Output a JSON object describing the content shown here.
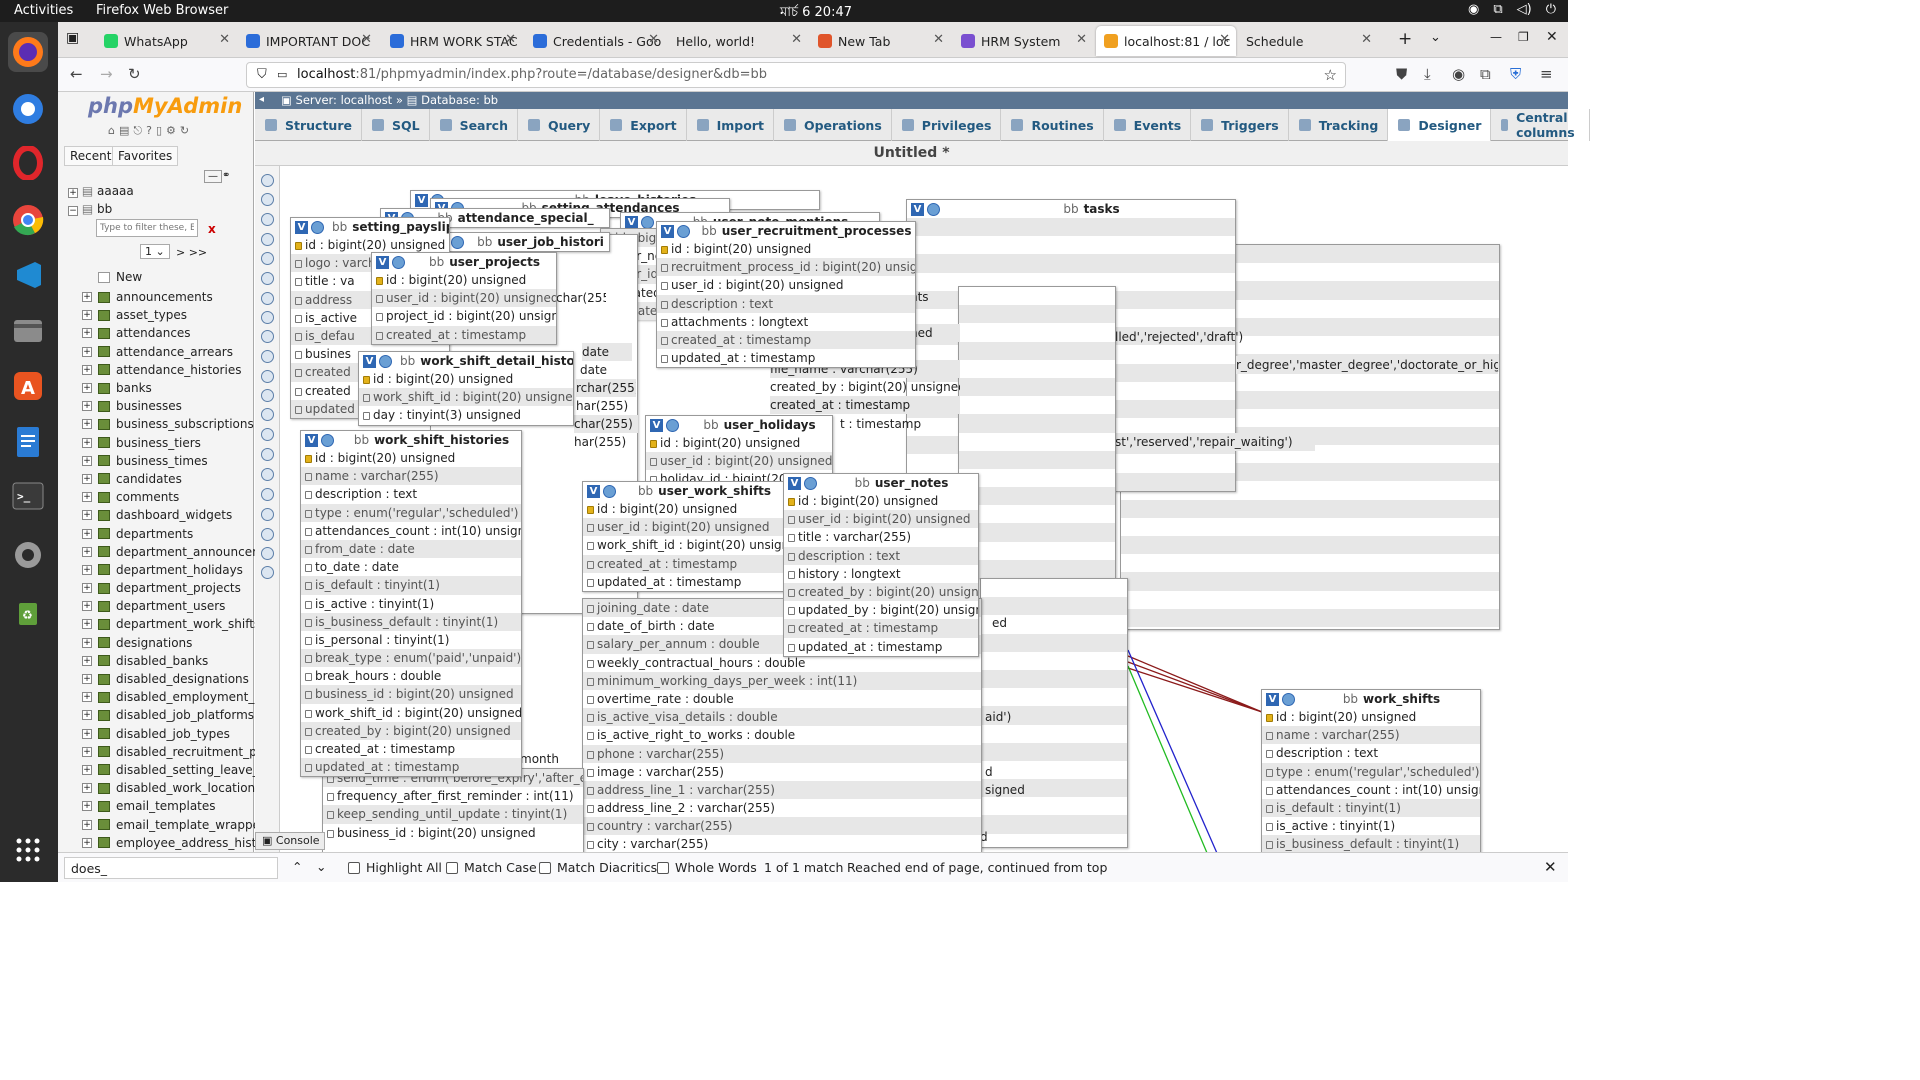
{
  "system": {
    "activities": "Activities",
    "app": "Firefox Web Browser",
    "clock": "মার্চ 6  20:47"
  },
  "tabs": [
    {
      "label": "WhatsApp",
      "color": "#25d366"
    },
    {
      "label": "IMPORTANT DOC",
      "color": "#2b6cd9"
    },
    {
      "label": "HRM WORK STAC",
      "color": "#2b6cd9"
    },
    {
      "label": "Credentials - Goo",
      "color": "#2b6cd9"
    },
    {
      "label": "Hello, world!",
      "color": ""
    },
    {
      "label": "New Tab",
      "color": "#e0552b"
    },
    {
      "label": "HRM System",
      "color": "#7a4fd0"
    },
    {
      "label": "localhost:81 / loc",
      "color": "#f0a020"
    },
    {
      "label": "Schedule",
      "color": ""
    }
  ],
  "url": {
    "host": "localhost",
    "rest": ":81/phpmyadmin/index.php?route=/database/designer&db=bb"
  },
  "sidebar": {
    "recent": "Recent",
    "favorites": "Favorites",
    "filter_placeholder": "Type to filter these, Enter",
    "filter_clear": "x",
    "page_select": "1",
    "page_next": "> >>",
    "dbs": [
      "aaaaa",
      "bb"
    ],
    "new_label": "New",
    "tables": [
      "announcements",
      "asset_types",
      "attendances",
      "attendance_arrears",
      "attendance_histories",
      "banks",
      "businesses",
      "business_subscriptions",
      "business_tiers",
      "business_times",
      "candidates",
      "comments",
      "dashboard_widgets",
      "departments",
      "department_announceme",
      "department_holidays",
      "department_projects",
      "department_users",
      "department_work_shifts",
      "designations",
      "disabled_banks",
      "disabled_designations",
      "disabled_employment_sta",
      "disabled_job_platforms",
      "disabled_job_types",
      "disabled_recruitment_proc",
      "disabled_setting_leave_typ",
      "disabled_work_locations",
      "email_templates",
      "email_template_wrappers",
      "employee_address_histori"
    ]
  },
  "breadcrumb": {
    "server": "Server: localhost",
    "sep": "»",
    "database": "Database: bb"
  },
  "menu": [
    "Structure",
    "SQL",
    "Search",
    "Query",
    "Export",
    "Import",
    "Operations",
    "Privileges",
    "Routines",
    "Events",
    "Triggers",
    "Tracking",
    "Designer",
    "Central columns"
  ],
  "designer_title": "Untitled *",
  "db_prefix": "bb",
  "tables": {
    "tasks": {
      "name": "tasks",
      "rows": []
    },
    "leave_histories": {
      "name": "leave_histories"
    },
    "attendance_special": {
      "name": "attendance_special_"
    },
    "setting_attendances": {
      "name": "setting_attendances"
    },
    "user_note_mentions": {
      "name": "user_note_mentions"
    },
    "setting_payslips": {
      "name": "setting_payslips",
      "rows": [
        "id : bigint(20) unsigned",
        "logo : varchar",
        "title : va",
        "address",
        "is_active",
        "is_defau",
        "busines",
        "created",
        "created",
        "updated"
      ]
    },
    "user_job_histories": {
      "name": "user_job_histori"
    },
    "user_projects": {
      "name": "user_projects",
      "rows": [
        "id : bigint(20) unsigned",
        "user_id : bigint(20) unsigned",
        "project_id : bigint(20) unsigned",
        "created_at : timestamp"
      ]
    },
    "user_recruitment_processes": {
      "name": "user_recruitment_processes",
      "rows": [
        "id : bigint(20) unsigned",
        "recruitment_process_id : bigint(20) unsigned",
        "user_id : bigint(20) unsigned",
        "description : text",
        "attachments : longtext",
        "created_at : timestamp",
        "updated_at : timestamp"
      ]
    },
    "work_shift_detail_histories": {
      "name": "work_shift_detail_histories",
      "rows": [
        "id : bigint(20) unsigned",
        "work_shift_id : bigint(20) unsigned",
        "day : tinyint(3) unsigned"
      ]
    },
    "user_holidays": {
      "name": "user_holidays",
      "rows": [
        "id : bigint(20) unsigned",
        "user_id : bigint(20) unsigned",
        "holiday_id : bigint(20)"
      ]
    },
    "work_shift_histories": {
      "name": "work_shift_histories",
      "rows": [
        "id : bigint(20) unsigned",
        "name : varchar(255)",
        "description : text",
        "type : enum('regular','scheduled')",
        "attendances_count : int(10) unsigned",
        "from_date : date",
        "to_date : date",
        "is_default : tinyint(1)",
        "is_active : tinyint(1)",
        "is_business_default : tinyint(1)",
        "is_personal : tinyint(1)",
        "break_type : enum('paid','unpaid')",
        "break_hours : double",
        "business_id : bigint(20) unsigned",
        "work_shift_id : bigint(20) unsigned",
        "created_by : bigint(20) unsigned",
        "created_at : timestamp",
        "updated_at : timestamp"
      ]
    },
    "user_work_shifts": {
      "name": "user_work_shifts",
      "rows": [
        "id : bigint(20) unsigned",
        "user_id : bigint(20) unsigned",
        "work_shift_id : bigint(20) unsigned",
        "created_at : timestamp",
        "updated_at : timestamp"
      ]
    },
    "user_notes": {
      "name": "user_notes",
      "rows": [
        "id : bigint(20) unsigned",
        "user_id : bigint(20) unsigned",
        "title : varchar(255)",
        "description : text",
        "history : longtext",
        "created_by : bigint(20) unsigned",
        "updated_by : bigint(20) unsigned",
        "created_at : timestamp",
        "updated_at : timestamp"
      ]
    },
    "employee_details": {
      "rows": [
        "joining_date : date",
        "date_of_birth : date",
        "salary_per_annum : double",
        "weekly_contractual_hours : double",
        "minimum_working_days_per_week : int(11)",
        "overtime_rate : double",
        "is_active_visa_details : double",
        "is_active_right_to_works : double",
        "phone : varchar(255)",
        "image : varchar(255)",
        "address_line_1 : varchar(255)",
        "address_line_2 : varchar(255)",
        "country : varchar(255)",
        "city : varchar(255)"
      ]
    },
    "reminders": {
      "rows": [
        "send_time : enum('before_expiry','after_expiry')",
        "frequency_after_first_reminder : int(11)",
        "keep_sending_until_update : tinyint(1)",
        "business_id : bigint(20) unsigned"
      ]
    },
    "work_shifts": {
      "name": "work_shifts",
      "rows": [
        "id : bigint(20) unsigned",
        "name : varchar(255)",
        "description : text",
        "type : enum('regular','scheduled')",
        "attendances_count : int(10) unsigned",
        "is_default : tinyint(1)",
        "is_active : tinyint(1)",
        "is_business_default : tinyint(1)"
      ]
    }
  },
  "fragments": {
    "f1": "lled','rejected','draft')",
    "f2": "r_degree','master_degree','doctorate_or_higher')",
    "f3": "st','reserved','repair_waiting')",
    "f4": "nts",
    "f5": "ned",
    "f6": "file_name : varchar(255)",
    "f7": "created_by : bigint(20) unsigned",
    "f8": "created_at : timestamp",
    "f9": "t : timestamp",
    "f10": "char(255)",
    "f11": "date",
    "f12": "date",
    "f13": "rchar(255)",
    "f14": "har(255)",
    "f15": "char(255)",
    "f16": "har(255)",
    "f17": "ed",
    "f18": "aid')",
    "f19": "d",
    "f20": "signed",
    "f21": "d",
    "f22": "month"
  },
  "console_label": "Console",
  "findbar": {
    "query": "does_",
    "highlight": "Highlight All",
    "match_case": "Match Case",
    "diacritics": "Match Diacritics",
    "whole": "Whole Words",
    "count": "1 of 1 match",
    "status": "Reached end of page, continued from top"
  },
  "colors": {
    "topbar": "#1d1d1d",
    "dock": "#2b2b2b",
    "crumb": "#5b7592",
    "menu_text": "#235a81",
    "relation_red": "#8b1a1a",
    "relation_blue": "#2222cc",
    "relation_green": "#22bb22"
  }
}
